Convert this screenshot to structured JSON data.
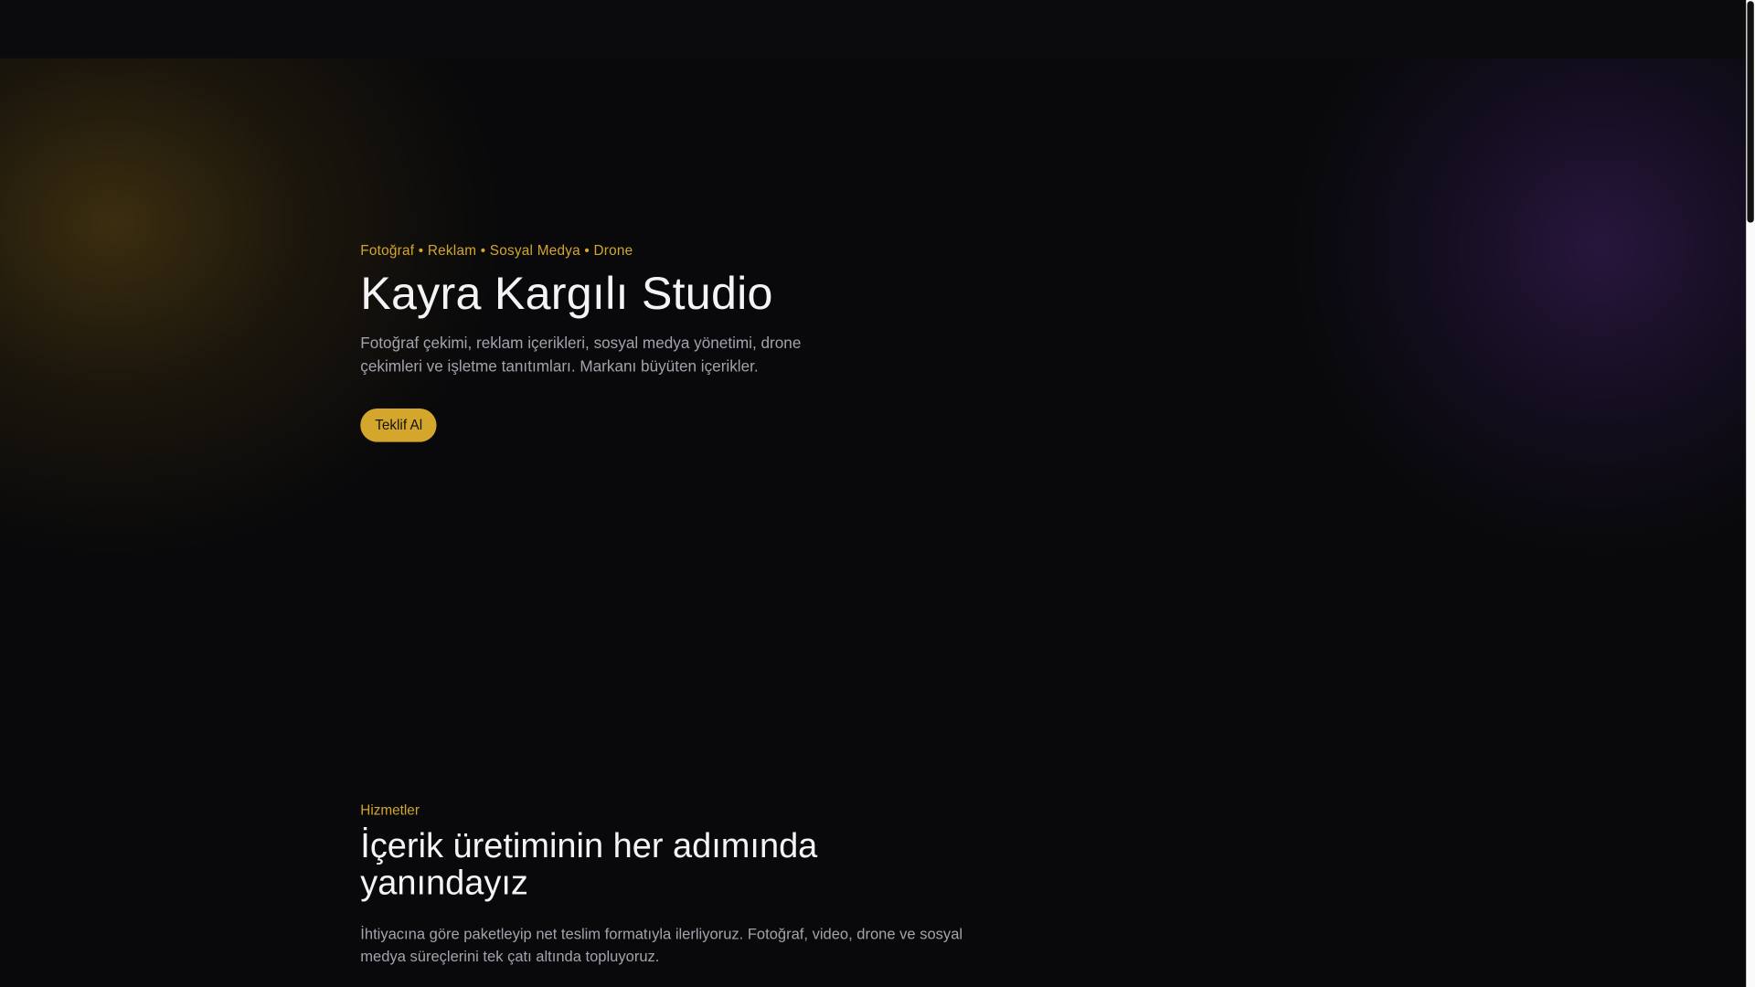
{
  "hero": {
    "tags": "Fotoğraf • Reklam • Sosyal Medya • Drone",
    "title": "Kayra Kargılı Studio",
    "lead": "Fotoğraf çekimi, reklam içerikleri, sosyal medya yönetimi, drone çekimleri ve işletme tanıtımları. Markanı büyüten içerikler.",
    "cta_label": "Teklif Al"
  },
  "services": {
    "eyebrow": "Hizmetler",
    "title": "İçerik üretiminin her adımında yanındayız",
    "description": "İhtiyacına göre paketleyip net teslim formatıyla ilerliyoruz. Fotoğraf, video, drone ve sosyal medya süreçlerini tek çatı altında topluyoruz."
  },
  "colors": {
    "accent": "#d4a72c",
    "background": "#09090b"
  }
}
